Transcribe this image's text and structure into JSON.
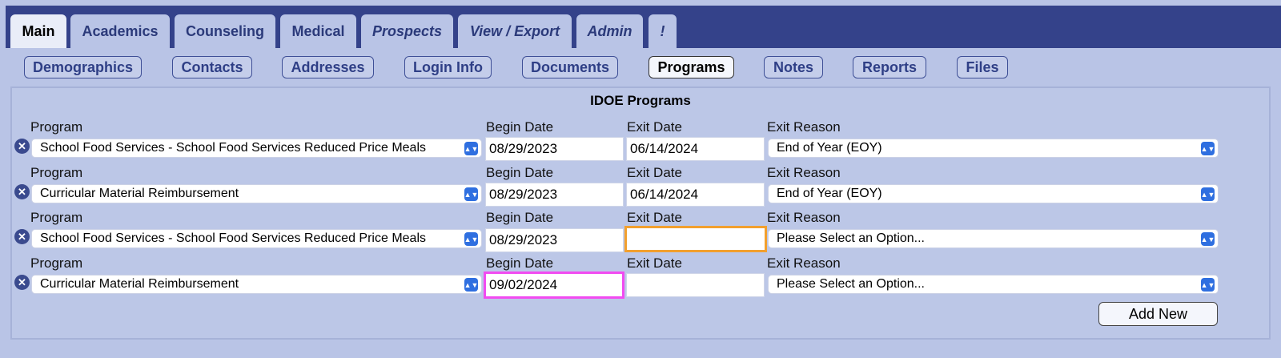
{
  "tabs": [
    {
      "label": "Main",
      "active": true,
      "italic": false
    },
    {
      "label": "Academics",
      "active": false,
      "italic": false
    },
    {
      "label": "Counseling",
      "active": false,
      "italic": false
    },
    {
      "label": "Medical",
      "active": false,
      "italic": false
    },
    {
      "label": "Prospects",
      "active": false,
      "italic": true
    },
    {
      "label": "View / Export",
      "active": false,
      "italic": true
    },
    {
      "label": "Admin",
      "active": false,
      "italic": true
    },
    {
      "label": "!",
      "active": false,
      "italic": true
    }
  ],
  "subtabs": [
    {
      "label": "Demographics",
      "active": false
    },
    {
      "label": "Contacts",
      "active": false
    },
    {
      "label": "Addresses",
      "active": false
    },
    {
      "label": "Login Info",
      "active": false
    },
    {
      "label": "Documents",
      "active": false
    },
    {
      "label": "Programs",
      "active": true
    },
    {
      "label": "Notes",
      "active": false
    },
    {
      "label": "Reports",
      "active": false
    },
    {
      "label": "Files",
      "active": false
    }
  ],
  "panel": {
    "title": "IDOE Programs",
    "labels": {
      "program": "Program",
      "begin": "Begin Date",
      "exit": "Exit Date",
      "reason": "Exit Reason"
    },
    "remove_icon": "remove-circle-icon",
    "rows": [
      {
        "program": "School Food Services - School Food Services Reduced Price Meals",
        "begin": "08/29/2023",
        "exit": "06/14/2024",
        "reason": "End of Year (EOY)"
      },
      {
        "program": "Curricular Material Reimbursement",
        "begin": "08/29/2023",
        "exit": "06/14/2024",
        "reason": "End of Year (EOY)"
      },
      {
        "program": "School Food Services - School Food Services Reduced Price Meals",
        "begin": "08/29/2023",
        "exit": "",
        "reason": "Please Select an Option..."
      },
      {
        "program": "Curricular Material Reimbursement",
        "begin": "09/02/2024",
        "exit": "",
        "reason": "Please Select an Option..."
      }
    ],
    "add_label": "Add New"
  },
  "colors": {
    "nav": "#34428a",
    "background": "#b9c4e6",
    "focus_orange": "#f2a02e",
    "focus_magenta": "#f14bf1",
    "select_arrow": "#2f6fe0"
  }
}
